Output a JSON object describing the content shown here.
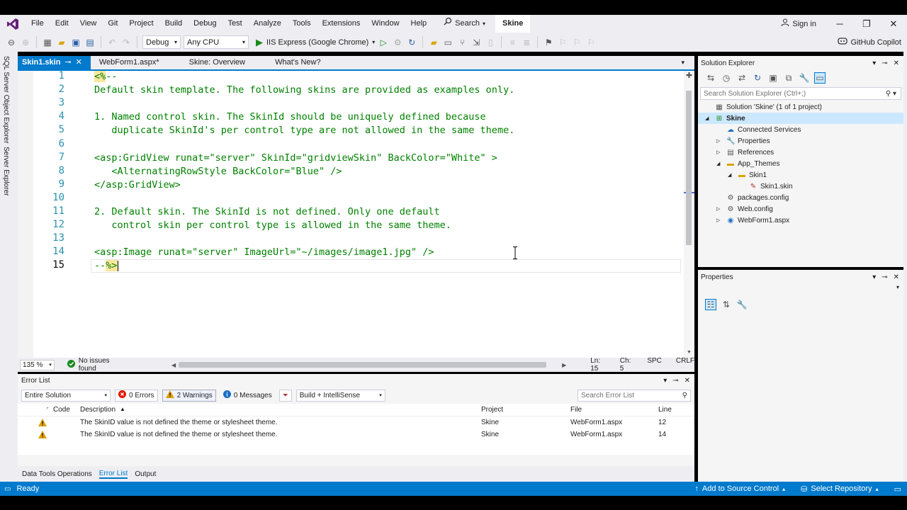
{
  "menu": [
    "File",
    "Edit",
    "View",
    "Git",
    "Project",
    "Build",
    "Debug",
    "Test",
    "Analyze",
    "Tools",
    "Extensions",
    "Window",
    "Help"
  ],
  "search_label": "Search",
  "solution_name": "Skine",
  "sign_in": "Sign in",
  "toolbar": {
    "config": "Debug",
    "platform": "Any CPU",
    "run_target": "IIS Express (Google Chrome)",
    "copilot": "GitHub Copilot"
  },
  "side_tabs": [
    "SQL Server Object Explorer",
    "Server Explorer"
  ],
  "editor_tabs": [
    {
      "label": "Skin1.skin",
      "active": true
    },
    {
      "label": "WebForm1.aspx*"
    },
    {
      "label": "Skine: Overview"
    },
    {
      "label": "What's New?"
    }
  ],
  "code_lines": [
    {
      "n": "1",
      "text": "<%--"
    },
    {
      "n": "2",
      "text": "Default skin template. The following skins are provided as examples only."
    },
    {
      "n": "3",
      "text": ""
    },
    {
      "n": "4",
      "text": "1. Named control skin. The SkinId should be uniquely defined because"
    },
    {
      "n": "5",
      "text": "   duplicate SkinId's per control type are not allowed in the same theme."
    },
    {
      "n": "6",
      "text": ""
    },
    {
      "n": "7",
      "text": "<asp:GridView runat=\"server\" SkinId=\"gridviewSkin\" BackColor=\"White\" >"
    },
    {
      "n": "8",
      "text": "   <AlternatingRowStyle BackColor=\"Blue\" />"
    },
    {
      "n": "9",
      "text": "</asp:GridView>"
    },
    {
      "n": "10",
      "text": ""
    },
    {
      "n": "11",
      "text": "2. Default skin. The SkinId is not defined. Only one default"
    },
    {
      "n": "12",
      "text": "   control skin per control type is allowed in the same theme."
    },
    {
      "n": "13",
      "text": ""
    },
    {
      "n": "14",
      "text": "<asp:Image runat=\"server\" ImageUrl=\"~/images/image1.jpg\" />"
    },
    {
      "n": "15",
      "text": "--%>"
    }
  ],
  "editor_status": {
    "zoom": "135 %",
    "issues": "No issues found",
    "line": "Ln: 15",
    "col": "Ch: 5",
    "spc": "SPC",
    "eol": "CRLF"
  },
  "error_list": {
    "title": "Error List",
    "scope": "Entire Solution",
    "errors": "0 Errors",
    "warnings": "2 Warnings",
    "messages": "0 Messages",
    "filter": "Build + IntelliSense",
    "search_placeholder": "Search Error List",
    "columns": [
      "Code",
      "Description",
      "Project",
      "File",
      "Line"
    ],
    "rows": [
      {
        "description": "The SkinID value is not defined the theme or stylesheet theme.",
        "project": "Skine",
        "file": "WebForm1.aspx",
        "line": "12"
      },
      {
        "description": "The SkinID value is not defined the theme or stylesheet theme.",
        "project": "Skine",
        "file": "WebForm1.aspx",
        "line": "14"
      }
    ]
  },
  "bottom_tabs": [
    {
      "label": "Data Tools Operations"
    },
    {
      "label": "Error List",
      "active": true
    },
    {
      "label": "Output"
    }
  ],
  "solution_explorer": {
    "title": "Solution Explorer",
    "search_placeholder": "Search Solution Explorer (Ctrl+;)",
    "nodes": [
      {
        "label": "Solution 'Skine' (1 of 1 project)",
        "level": 0,
        "icon": "solution-icon"
      },
      {
        "label": "Skine",
        "level": 0,
        "icon": "project-icon",
        "selected": true,
        "expand": "open"
      },
      {
        "label": "Connected Services",
        "level": 1,
        "icon": "cloud-icon"
      },
      {
        "label": "Properties",
        "level": 1,
        "icon": "wrench-icon",
        "expand": "closed"
      },
      {
        "label": "References",
        "level": 1,
        "icon": "references-icon",
        "expand": "closed"
      },
      {
        "label": "App_Themes",
        "level": 1,
        "icon": "folder-icon",
        "expand": "open"
      },
      {
        "label": "Skin1",
        "level": 2,
        "icon": "folder-icon",
        "expand": "open"
      },
      {
        "label": "Skin1.skin",
        "level": 3,
        "icon": "skin-file-icon"
      },
      {
        "label": "packages.config",
        "level": 1,
        "icon": "config-icon"
      },
      {
        "label": "Web.config",
        "level": 1,
        "icon": "config-icon",
        "expand": "closed"
      },
      {
        "label": "WebForm1.aspx",
        "level": 1,
        "icon": "web-icon",
        "expand": "closed"
      }
    ]
  },
  "properties_title": "Properties",
  "status": {
    "ready": "Ready",
    "source_control": "Add to Source Control",
    "repository": "Select Repository"
  },
  "colors": {
    "accent": "#007acc",
    "code_green": "#008000",
    "line_number": "#2b91af",
    "warning": "#e0a000"
  }
}
